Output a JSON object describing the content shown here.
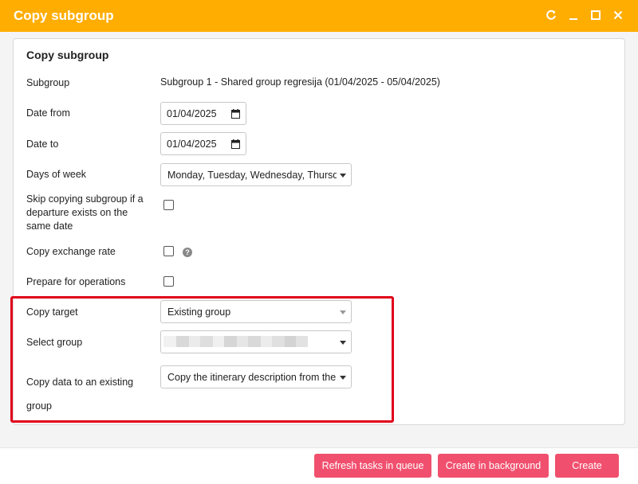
{
  "window": {
    "title": "Copy subgroup",
    "controls": [
      "refresh-icon",
      "minimize-icon",
      "maximize-icon",
      "close-icon"
    ]
  },
  "form": {
    "heading": "Copy subgroup",
    "subgroup": {
      "label": "Subgroup",
      "value": "Subgroup 1 - Shared group regresija (01/04/2025 - 05/04/2025)"
    },
    "date_from": {
      "label": "Date from",
      "value": "01/04/2025"
    },
    "date_to": {
      "label": "Date to",
      "value": "01/04/2025"
    },
    "days_of_week": {
      "label": "Days of week",
      "value": "Monday, Tuesday, Wednesday, Thursday, Friday, Saturday, Sunday"
    },
    "skip_copying": {
      "label": "Skip copying subgroup if a departure exists on the same date",
      "checked": false
    },
    "copy_exchange_rate": {
      "label": "Copy exchange rate",
      "checked": false,
      "help_icon": "question-circle-icon"
    },
    "prepare_operations": {
      "label": "Prepare for operations",
      "checked": false
    },
    "copy_target": {
      "label": "Copy target",
      "value": "Existing group"
    },
    "select_group": {
      "label": "Select group",
      "value": ""
    },
    "copy_data": {
      "label": "Copy data to an existing group",
      "value": "Copy the itinerary description from the subgroup"
    }
  },
  "footer": {
    "refresh_tasks": "Refresh tasks in queue",
    "create_background": "Create in background",
    "create": "Create"
  },
  "colors": {
    "titlebar": "#ffad00",
    "primary_button": "#f0506e",
    "highlight": "#e0001a"
  }
}
